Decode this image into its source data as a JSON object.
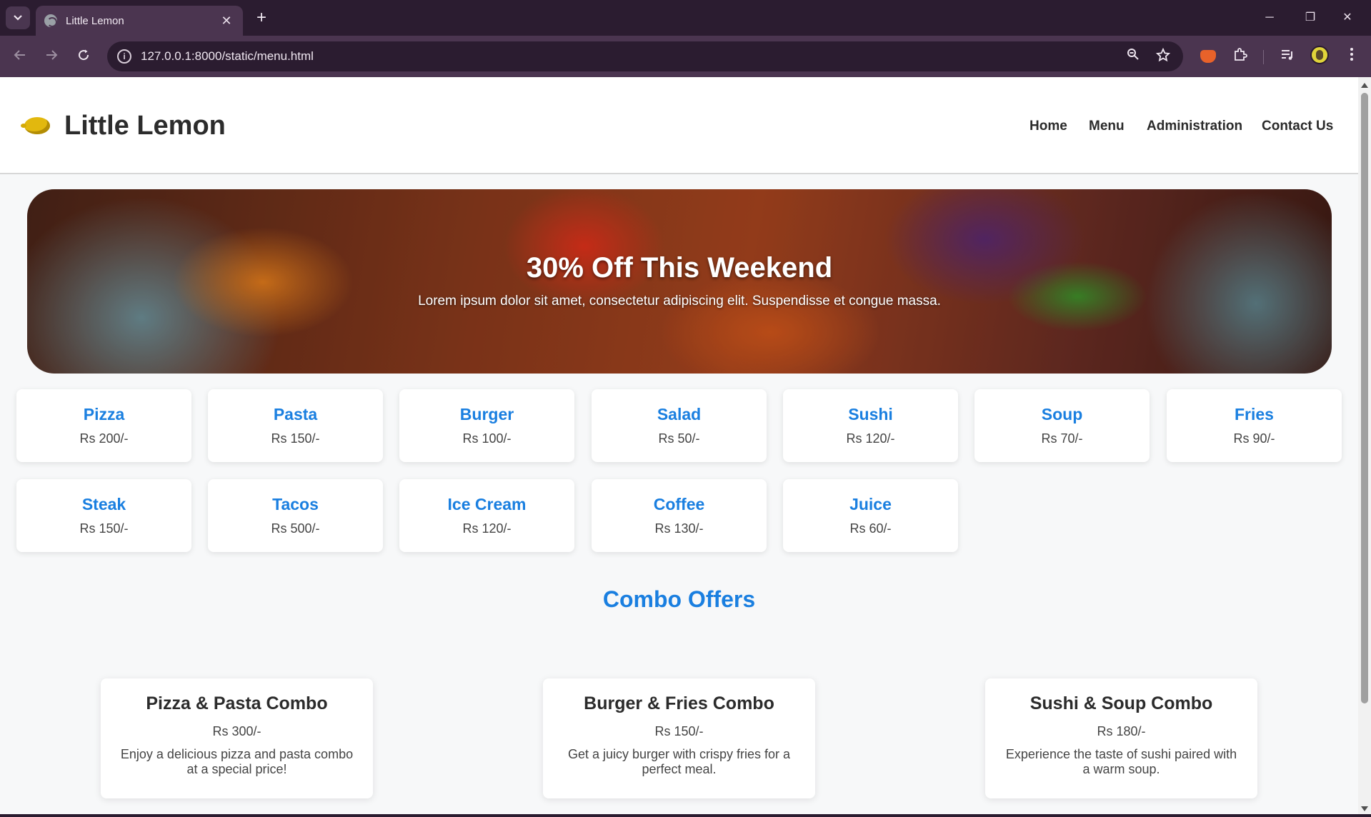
{
  "browser": {
    "tab_title": "Little Lemon",
    "url": "127.0.0.1:8000/static/menu.html",
    "tab_close": "✕",
    "new_tab": "+",
    "minimize": "─",
    "restore": "❐",
    "close": "✕"
  },
  "header": {
    "site_title": "Little Lemon",
    "nav": [
      "Home",
      "Menu",
      "Administration",
      "Contact Us"
    ]
  },
  "banner": {
    "title": "30% Off This Weekend",
    "text": "Lorem ipsum dolor sit amet, consectetur adipiscing elit. Suspendisse et congue massa."
  },
  "menu_items": [
    {
      "name": "Pizza",
      "price": "Rs 200/-"
    },
    {
      "name": "Pasta",
      "price": "Rs 150/-"
    },
    {
      "name": "Burger",
      "price": "Rs 100/-"
    },
    {
      "name": "Salad",
      "price": "Rs 50/-"
    },
    {
      "name": "Sushi",
      "price": "Rs 120/-"
    },
    {
      "name": "Soup",
      "price": "Rs 70/-"
    },
    {
      "name": "Fries",
      "price": "Rs 90/-"
    },
    {
      "name": "Steak",
      "price": "Rs 150/-"
    },
    {
      "name": "Tacos",
      "price": "Rs 500/-"
    },
    {
      "name": "Ice Cream",
      "price": "Rs 120/-"
    },
    {
      "name": "Coffee",
      "price": "Rs 130/-"
    },
    {
      "name": "Juice",
      "price": "Rs 60/-"
    }
  ],
  "combo": {
    "heading": "Combo Offers",
    "items": [
      {
        "name": "Pizza & Pasta Combo",
        "price": "Rs 300/-",
        "description": "Enjoy a delicious pizza and pasta combo at a special price!"
      },
      {
        "name": "Burger & Fries Combo",
        "price": "Rs 150/-",
        "description": "Get a juicy burger with crispy fries for a perfect meal."
      },
      {
        "name": "Sushi & Soup Combo",
        "price": "Rs 180/-",
        "description": "Experience the taste of sushi paired with a warm soup."
      }
    ]
  },
  "colors": {
    "accent": "#1a7fe0",
    "chrome_dark": "#2b1c30",
    "chrome_mid": "#4b3550",
    "page_bg": "#f7f8f9"
  }
}
